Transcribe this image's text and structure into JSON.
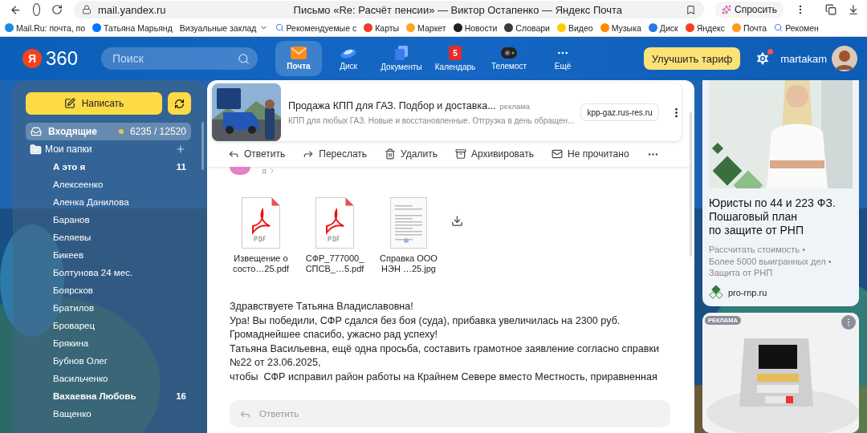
{
  "browser": {
    "address": "mail.yandex.ru",
    "title": "Письмо «Re: Расчёт пенсии» — Виктор Остапенко — Яндекс Почта",
    "ask_button": "Спросить"
  },
  "bookmarks": [
    {
      "label": "Mail.Ru: почта, по",
      "kind": "site",
      "color": "#168de2"
    },
    {
      "label": "Татьяна Марьянд",
      "kind": "site",
      "color": "#0077ff"
    },
    {
      "label": "Визуальные заклад",
      "kind": "folder"
    },
    {
      "label": "Рекомендуемые с",
      "kind": "search"
    },
    {
      "label": "Карты",
      "kind": "site",
      "color": "#f43b2c"
    },
    {
      "label": "Маркет",
      "kind": "site",
      "color": "#f9a825"
    },
    {
      "label": "Новости",
      "kind": "site",
      "color": "#222222"
    },
    {
      "label": "Словари",
      "kind": "site",
      "color": "#3b3b3b"
    },
    {
      "label": "Видео",
      "kind": "site",
      "color": "#ffcc00"
    },
    {
      "label": "Музыка",
      "kind": "site",
      "color": "#ff8a00"
    },
    {
      "label": "Диск",
      "kind": "site",
      "color": "#2a7ae2"
    },
    {
      "label": "Яндекс",
      "kind": "site",
      "color": "#fc3f1d"
    },
    {
      "label": "Почта",
      "kind": "site",
      "color": "#ff9a1f"
    },
    {
      "label": "Рекомен",
      "kind": "search"
    }
  ],
  "header": {
    "logo_letter": "Я",
    "logo_number": "360",
    "search_placeholder": "Поиск",
    "services": [
      {
        "label": "Почта",
        "kind": "mail",
        "selected": true
      },
      {
        "label": "Диск",
        "kind": "disk",
        "selected": false
      },
      {
        "label": "Документы",
        "kind": "docs",
        "selected": false
      },
      {
        "label": "Календарь",
        "kind": "calendar",
        "selected": false,
        "badge": "5"
      },
      {
        "label": "Телемост",
        "kind": "telemost",
        "selected": false
      },
      {
        "label": "Ещё",
        "kind": "more",
        "selected": false
      }
    ],
    "upgrade_button": "Улучшить тариф",
    "settings_notification": true,
    "username": "martakam"
  },
  "sidebar": {
    "compose_button": "Написать",
    "inbox": {
      "label": "Входящие",
      "count": "6235 / 12520",
      "selected": true
    },
    "my_folders": "Мои папки",
    "folders": [
      {
        "name": "А это я",
        "count": "11",
        "unread": true
      },
      {
        "name": "Алексеенко",
        "unread": false
      },
      {
        "name": "Аленка Данилова",
        "unread": false
      },
      {
        "name": "Баранов",
        "unread": false
      },
      {
        "name": "Беляевы",
        "unread": false
      },
      {
        "name": "Бикеев",
        "unread": false
      },
      {
        "name": "Болтунова 24 мес.",
        "unread": false
      },
      {
        "name": "Боярсков",
        "unread": false
      },
      {
        "name": "Братилов",
        "unread": false
      },
      {
        "name": "Броварец",
        "unread": false
      },
      {
        "name": "Брякина",
        "unread": false
      },
      {
        "name": "Бубнов Олег",
        "unread": false
      },
      {
        "name": "Васильченко",
        "unread": false
      },
      {
        "name": "Вахаевна Любовь",
        "count": "16",
        "unread": true
      },
      {
        "name": "Ващенко",
        "unread": false
      }
    ]
  },
  "ad_banner": {
    "title": "Продажа КПП для ГАЗ. Подбор и доставка...",
    "tag": "реклама",
    "text": "КПП для любых ГАЗ. Новые и восстановленные. Отгрузка в день обращен...",
    "domain": "kpp-gaz.rus-res.ru"
  },
  "toolbar": [
    {
      "label": "Ответить",
      "kind": "reply"
    },
    {
      "label": "Переслать",
      "kind": "forward"
    },
    {
      "label": "Удалить",
      "kind": "delete"
    },
    {
      "label": "Архивировать",
      "kind": "archive"
    },
    {
      "label": "Не прочитано",
      "kind": "unread"
    }
  ],
  "message": {
    "recipient": "я",
    "attachments": [
      {
        "kind": "pdf",
        "name": "Извещение о\nсосто…25.pdf"
      },
      {
        "kind": "pdf",
        "name": "СФР_777000_\nСПСВ_…5.pdf"
      },
      {
        "name": "Справка ООО\nНЭН …25.jpg"
      }
    ],
    "body": [
      "Здравствуете Татьяна Владиславовна!",
      "Ура! Вы победили, СФР сдался без боя (суда), прибавка увеличилась на 2300 руб.",
      "Громаднейшее спасибо, ужасно рад успеху!",
      "Татьяна Васильевна, ещё одна просьба, составить грамотное заявление согласно справки",
      "№22 от 23.06.2025,",
      "чтобы  СФР исправил район работы на Крайнем Севере вместо Местность, приравненная"
    ],
    "reply_placeholder": "Ответить"
  },
  "right_ads": {
    "title": "Юристы по 44 и 223 ФЗ.\nПошаговый план\nпо защите от РНП",
    "features": [
      "Рассчитать стоимость •",
      "Более 5000 выигранных дел •",
      "Защита от РНП"
    ],
    "domain": "pro-rnp.ru",
    "second_label": "РЕКЛАМА"
  }
}
